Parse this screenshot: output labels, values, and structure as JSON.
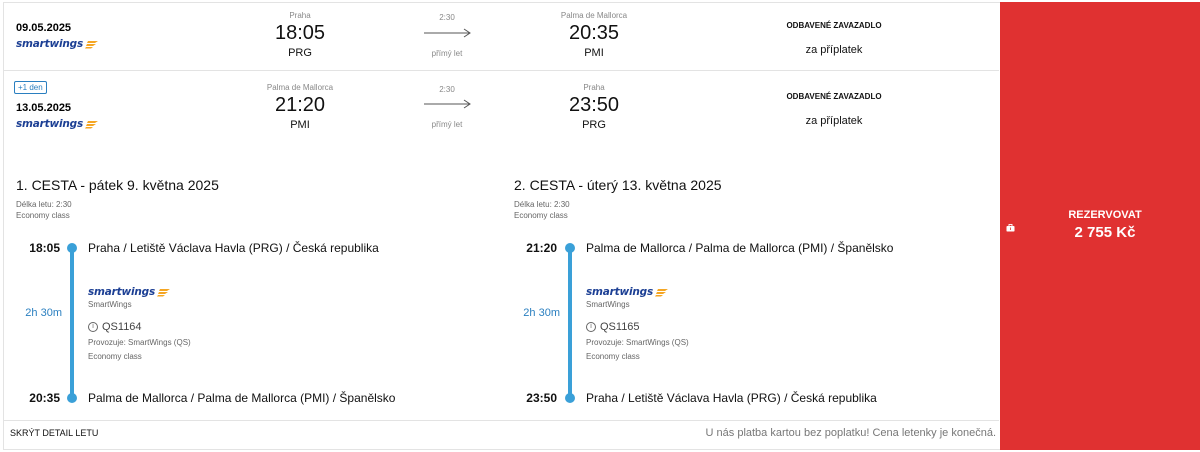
{
  "outbound": {
    "date": "09.05.2025",
    "airline_logo": "smartwings",
    "dep_city": "Praha",
    "dep_time": "18:05",
    "dep_iata": "PRG",
    "duration": "2:30",
    "stops": "přímý let",
    "arr_city": "Palma de Mallorca",
    "arr_time": "20:35",
    "arr_iata": "PMI",
    "baggage_title": "ODBAVENÉ ZAVAZADLO",
    "baggage_note": "za příplatek"
  },
  "inbound": {
    "next_day_badge": "+1 den",
    "date": "13.05.2025",
    "airline_logo": "smartwings",
    "dep_city": "Palma de Mallorca",
    "dep_time": "21:20",
    "dep_iata": "PMI",
    "duration": "2:30",
    "stops": "přímý let",
    "arr_city": "Praha",
    "arr_time": "23:50",
    "arr_iata": "PRG",
    "baggage_title": "ODBAVENÉ ZAVAZADLO",
    "baggage_note": "za příplatek"
  },
  "details": [
    {
      "title": "1. CESTA - pátek 9. května 2025",
      "length": "Délka letu: 2:30",
      "cabin": "Economy class",
      "dep_time": "18:05",
      "dep_place": "Praha / Letiště Václava Havla (PRG) / Česká republika",
      "segment_duration": "2h 30m",
      "airline_logo": "smartwings",
      "airline_name": "SmartWings",
      "flight_no": "QS1164",
      "operated": "Provozuje: SmartWings (QS)",
      "segment_class": "Economy class",
      "arr_time": "20:35",
      "arr_place": "Palma de Mallorca / Palma de Mallorca (PMI) / Španělsko"
    },
    {
      "title": "2. CESTA - úterý 13. května 2025",
      "length": "Délka letu: 2:30",
      "cabin": "Economy class",
      "dep_time": "21:20",
      "dep_place": "Palma de Mallorca / Palma de Mallorca (PMI) / Španělsko",
      "segment_duration": "2h 30m",
      "airline_logo": "smartwings",
      "airline_name": "SmartWings",
      "flight_no": "QS1165",
      "operated": "Provozuje: SmartWings (QS)",
      "segment_class": "Economy class",
      "arr_time": "23:50",
      "arr_place": "Praha / Letiště Václava Havla (PRG) / Česká republika"
    }
  ],
  "footer": {
    "hide_detail": "SKRÝT DETAIL LETU",
    "payment_note": "U nás platba kartou bez poplatku! Cena letenky je konečná."
  },
  "booking": {
    "button_label": "REZERVOVAT",
    "price": "2 755 Kč",
    "icon": "suitcase-icon"
  },
  "colors": {
    "accent_blue": "#3aa0d8",
    "book_red": "#e03131",
    "logo_navy": "#1c3f94",
    "logo_orange": "#f5a623"
  }
}
